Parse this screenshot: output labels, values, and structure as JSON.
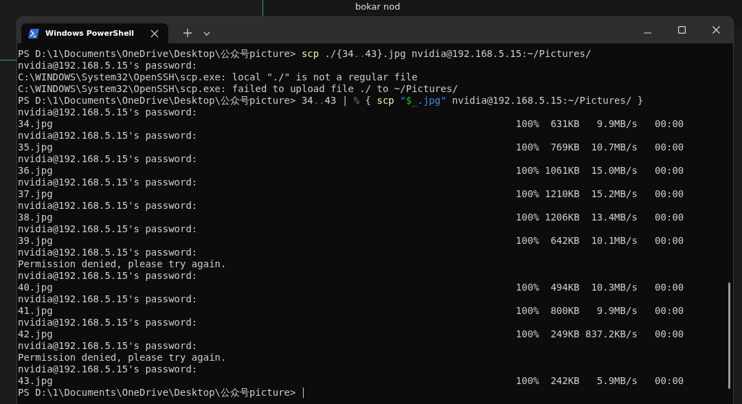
{
  "background": {
    "text": "bokar nod"
  },
  "window": {
    "tabs": [
      {
        "title": "Windows PowerShell",
        "selected": true
      }
    ]
  },
  "terminal": {
    "lines": [
      {
        "kind": "command",
        "segments": [
          {
            "kind": "prompt",
            "text": "PS D:\\1\\Documents\\OneDrive\\Desktop\\公众号picture> "
          },
          {
            "kind": "cmd",
            "text": "scp"
          },
          {
            "kind": "arg",
            "text": " ./{34"
          },
          {
            "kind": "dim",
            "text": ".."
          },
          {
            "kind": "arg",
            "text": "43}.jpg nvidia@192.168.5.15:~/Pictures/"
          }
        ]
      },
      {
        "kind": "output",
        "text": "nvidia@192.168.5.15's password:"
      },
      {
        "kind": "output",
        "text": "C:\\WINDOWS\\System32\\OpenSSH\\scp.exe: local \"./\" is not a regular file"
      },
      {
        "kind": "output",
        "text": "C:\\WINDOWS\\System32\\OpenSSH\\scp.exe: failed to upload file ./ to ~/Pictures/"
      },
      {
        "kind": "command",
        "segments": [
          {
            "kind": "prompt",
            "text": "PS D:\\1\\Documents\\OneDrive\\Desktop\\公众号picture> "
          },
          {
            "kind": "arg",
            "text": "34"
          },
          {
            "kind": "dim",
            "text": ".."
          },
          {
            "kind": "arg",
            "text": "43 | "
          },
          {
            "kind": "dim",
            "text": "%"
          },
          {
            "kind": "arg",
            "text": " { "
          },
          {
            "kind": "cmd",
            "text": "scp"
          },
          {
            "kind": "string",
            "text": " \""
          },
          {
            "kind": "variable",
            "text": "$_"
          },
          {
            "kind": "string",
            "text": ".jpg\""
          },
          {
            "kind": "arg",
            "text": " nvidia@192.168.5.15:~/Pictures/ }"
          }
        ]
      },
      {
        "kind": "output",
        "text": "nvidia@192.168.5.15's password:"
      },
      {
        "kind": "progress",
        "file": "34.jpg",
        "percent": "100%",
        "size": "631KB",
        "speed": "9.9MB/s",
        "eta": "00:00"
      },
      {
        "kind": "output",
        "text": "nvidia@192.168.5.15's password:"
      },
      {
        "kind": "progress",
        "file": "35.jpg",
        "percent": "100%",
        "size": "769KB",
        "speed": "10.7MB/s",
        "eta": "00:00"
      },
      {
        "kind": "output",
        "text": "nvidia@192.168.5.15's password:"
      },
      {
        "kind": "progress",
        "file": "36.jpg",
        "percent": "100%",
        "size": "1061KB",
        "speed": "15.0MB/s",
        "eta": "00:00"
      },
      {
        "kind": "output",
        "text": "nvidia@192.168.5.15's password:"
      },
      {
        "kind": "progress",
        "file": "37.jpg",
        "percent": "100%",
        "size": "1210KB",
        "speed": "15.2MB/s",
        "eta": "00:00"
      },
      {
        "kind": "output",
        "text": "nvidia@192.168.5.15's password:"
      },
      {
        "kind": "progress",
        "file": "38.jpg",
        "percent": "100%",
        "size": "1206KB",
        "speed": "13.4MB/s",
        "eta": "00:00"
      },
      {
        "kind": "output",
        "text": "nvidia@192.168.5.15's password:"
      },
      {
        "kind": "progress",
        "file": "39.jpg",
        "percent": "100%",
        "size": "642KB",
        "speed": "10.1MB/s",
        "eta": "00:00"
      },
      {
        "kind": "output",
        "text": "nvidia@192.168.5.15's password:"
      },
      {
        "kind": "output",
        "text": "Permission denied, please try again."
      },
      {
        "kind": "output",
        "text": "nvidia@192.168.5.15's password:"
      },
      {
        "kind": "progress",
        "file": "40.jpg",
        "percent": "100%",
        "size": "494KB",
        "speed": "10.3MB/s",
        "eta": "00:00"
      },
      {
        "kind": "output",
        "text": "nvidia@192.168.5.15's password:"
      },
      {
        "kind": "progress",
        "file": "41.jpg",
        "percent": "100%",
        "size": "800KB",
        "speed": "9.9MB/s",
        "eta": "00:00"
      },
      {
        "kind": "output",
        "text": "nvidia@192.168.5.15's password:"
      },
      {
        "kind": "progress",
        "file": "42.jpg",
        "percent": "100%",
        "size": "249KB",
        "speed": "837.2KB/s",
        "eta": "00:00"
      },
      {
        "kind": "output",
        "text": "nvidia@192.168.5.15's password:"
      },
      {
        "kind": "output",
        "text": "Permission denied, please try again."
      },
      {
        "kind": "output",
        "text": "nvidia@192.168.5.15's password:"
      },
      {
        "kind": "progress",
        "file": "43.jpg",
        "percent": "100%",
        "size": "242KB",
        "speed": "5.9MB/s",
        "eta": "00:00"
      },
      {
        "kind": "command",
        "cursor": true,
        "segments": [
          {
            "kind": "prompt",
            "text": "PS D:\\1\\Documents\\OneDrive\\Desktop\\公众号picture> "
          }
        ]
      }
    ]
  }
}
